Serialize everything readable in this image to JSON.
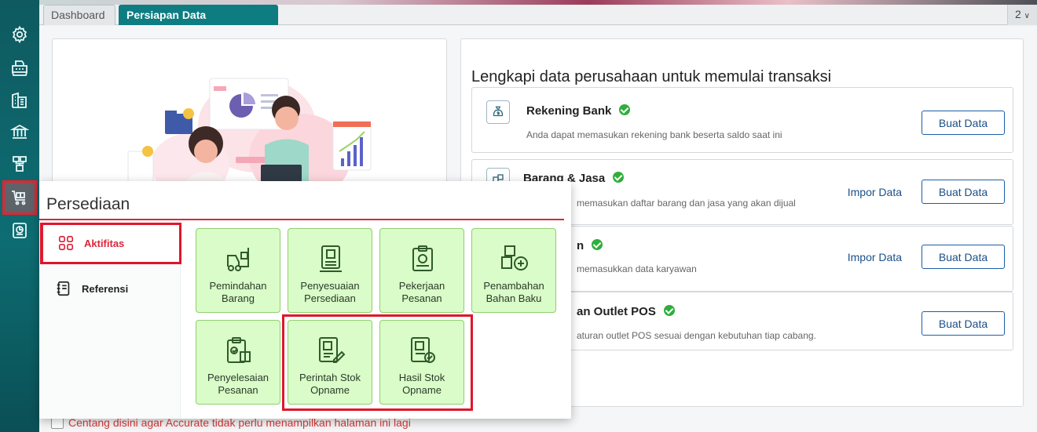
{
  "tabs": {
    "dashboard": "Dashboard",
    "setup": "Persiapan Data Perusahaan",
    "count": "2"
  },
  "right_panel": {
    "title": "Lengkapi data perusahaan untuk memulai transaksi",
    "items": [
      {
        "title": "Rekening Bank",
        "desc": "Anda dapat memasukan rekening bank beserta saldo saat ini",
        "button": "Buat Data",
        "import": ""
      },
      {
        "title": "Barang & Jasa",
        "desc": "memasukan daftar barang dan jasa yang akan dijual",
        "button": "Buat Data",
        "import": "Impor Data"
      },
      {
        "title": "n",
        "desc": "memasukkan data karyawan",
        "button": "Buat Data",
        "import": "Impor Data"
      },
      {
        "title": "an Outlet POS",
        "desc": "aturan outlet POS sesuai dengan kebutuhan tiap cabang.",
        "button": "Buat Data",
        "import": ""
      }
    ]
  },
  "footer": {
    "text": "Centang disini agar Accurate tidak perlu menampilkan halaman ini lagi"
  },
  "popup": {
    "title": "Persediaan",
    "menu": {
      "active": "Aktifitas",
      "referensi": "Referensi"
    },
    "tiles": [
      {
        "label": "Pemindahan Barang",
        "icon": "forklift-icon"
      },
      {
        "label": "Penyesuaian Persediaan",
        "icon": "adjustment-icon"
      },
      {
        "label": "Pekerjaan Pesanan",
        "icon": "work-order-icon"
      },
      {
        "label": "Penambahan Bahan Baku",
        "icon": "add-material-icon"
      },
      {
        "label": "Penyelesaian Pesanan",
        "icon": "order-complete-icon"
      },
      {
        "label": "Perintah Stok Opname",
        "icon": "stock-order-icon"
      },
      {
        "label": "Hasil Stok Opname",
        "icon": "stock-result-icon"
      }
    ]
  },
  "colors": {
    "sidebar": "#0d6d72",
    "accent_red": "#d9263a",
    "tile_bg": "#d9fcc8",
    "check_green": "#2fae3c"
  }
}
